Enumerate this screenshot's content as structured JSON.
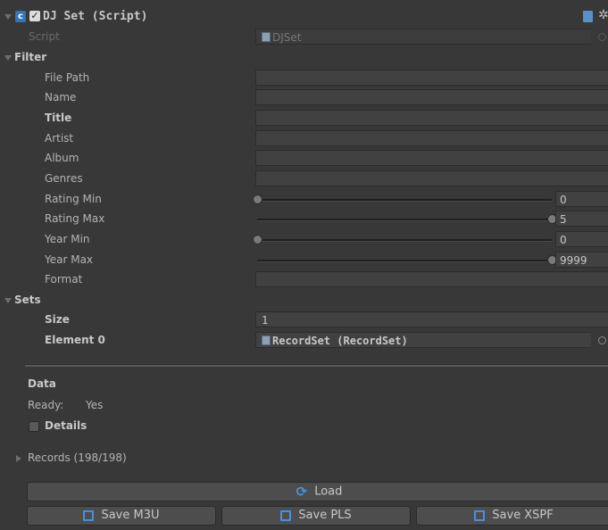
{
  "component": {
    "title": "DJ Set (Script)",
    "script_label": "Script",
    "script_value": "DJSet"
  },
  "filter": {
    "header": "Filter",
    "fields": [
      {
        "label": "File Path",
        "value": ""
      },
      {
        "label": "Name",
        "value": ""
      },
      {
        "label": "Title",
        "value": ""
      },
      {
        "label": "Artist",
        "value": ""
      },
      {
        "label": "Album",
        "value": ""
      },
      {
        "label": "Genres",
        "value": ""
      }
    ],
    "rating_min": {
      "label": "Rating Min",
      "value": "0",
      "min": 0,
      "max": 5,
      "current": 0
    },
    "rating_max": {
      "label": "Rating Max",
      "value": "5",
      "min": 0,
      "max": 5,
      "current": 5
    },
    "year_min": {
      "label": "Year Min",
      "value": "0",
      "min": 0,
      "max": 9999,
      "current": 0
    },
    "year_max": {
      "label": "Year Max",
      "value": "9999",
      "min": 0,
      "max": 9999,
      "current": 9999
    },
    "format": {
      "label": "Format",
      "value": ""
    }
  },
  "sets": {
    "header": "Sets",
    "size_label": "Size",
    "size_value": "1",
    "element_label": "Element 0",
    "element_value": "RecordSet (RecordSet)"
  },
  "data": {
    "header": "Data",
    "ready_label": "Ready:",
    "ready_value": "Yes",
    "details_label": "Details",
    "records_label": "Records (198/198)"
  },
  "buttons": {
    "load": "Load",
    "save_m3u": "Save M3U",
    "save_pls": "Save PLS",
    "save_xspf": "Save XSPF"
  },
  "colors": {
    "background": "#383838",
    "field": "#414141",
    "button": "#4d4d4d",
    "icon_blue": "#4a90d9"
  }
}
